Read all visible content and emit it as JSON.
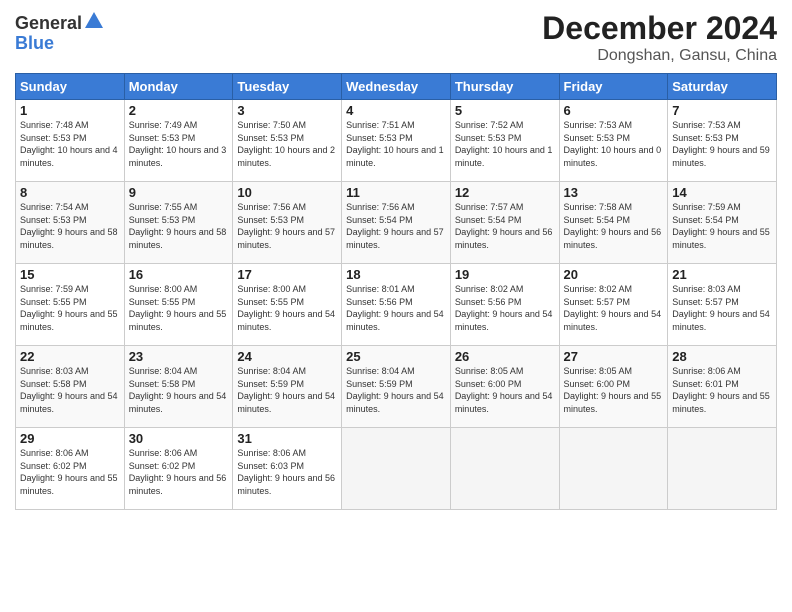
{
  "logo": {
    "general": "General",
    "blue": "Blue"
  },
  "header": {
    "month": "December 2024",
    "location": "Dongshan, Gansu, China"
  },
  "weekdays": [
    "Sunday",
    "Monday",
    "Tuesday",
    "Wednesday",
    "Thursday",
    "Friday",
    "Saturday"
  ],
  "weeks": [
    [
      {
        "day": "1",
        "sunrise": "7:48 AM",
        "sunset": "5:53 PM",
        "daylight": "10 hours and 4 minutes."
      },
      {
        "day": "2",
        "sunrise": "7:49 AM",
        "sunset": "5:53 PM",
        "daylight": "10 hours and 3 minutes."
      },
      {
        "day": "3",
        "sunrise": "7:50 AM",
        "sunset": "5:53 PM",
        "daylight": "10 hours and 2 minutes."
      },
      {
        "day": "4",
        "sunrise": "7:51 AM",
        "sunset": "5:53 PM",
        "daylight": "10 hours and 1 minute."
      },
      {
        "day": "5",
        "sunrise": "7:52 AM",
        "sunset": "5:53 PM",
        "daylight": "10 hours and 1 minute."
      },
      {
        "day": "6",
        "sunrise": "7:53 AM",
        "sunset": "5:53 PM",
        "daylight": "10 hours and 0 minutes."
      },
      {
        "day": "7",
        "sunrise": "7:53 AM",
        "sunset": "5:53 PM",
        "daylight": "9 hours and 59 minutes."
      }
    ],
    [
      {
        "day": "8",
        "sunrise": "7:54 AM",
        "sunset": "5:53 PM",
        "daylight": "9 hours and 58 minutes."
      },
      {
        "day": "9",
        "sunrise": "7:55 AM",
        "sunset": "5:53 PM",
        "daylight": "9 hours and 58 minutes."
      },
      {
        "day": "10",
        "sunrise": "7:56 AM",
        "sunset": "5:53 PM",
        "daylight": "9 hours and 57 minutes."
      },
      {
        "day": "11",
        "sunrise": "7:56 AM",
        "sunset": "5:54 PM",
        "daylight": "9 hours and 57 minutes."
      },
      {
        "day": "12",
        "sunrise": "7:57 AM",
        "sunset": "5:54 PM",
        "daylight": "9 hours and 56 minutes."
      },
      {
        "day": "13",
        "sunrise": "7:58 AM",
        "sunset": "5:54 PM",
        "daylight": "9 hours and 56 minutes."
      },
      {
        "day": "14",
        "sunrise": "7:59 AM",
        "sunset": "5:54 PM",
        "daylight": "9 hours and 55 minutes."
      }
    ],
    [
      {
        "day": "15",
        "sunrise": "7:59 AM",
        "sunset": "5:55 PM",
        "daylight": "9 hours and 55 minutes."
      },
      {
        "day": "16",
        "sunrise": "8:00 AM",
        "sunset": "5:55 PM",
        "daylight": "9 hours and 55 minutes."
      },
      {
        "day": "17",
        "sunrise": "8:00 AM",
        "sunset": "5:55 PM",
        "daylight": "9 hours and 54 minutes."
      },
      {
        "day": "18",
        "sunrise": "8:01 AM",
        "sunset": "5:56 PM",
        "daylight": "9 hours and 54 minutes."
      },
      {
        "day": "19",
        "sunrise": "8:02 AM",
        "sunset": "5:56 PM",
        "daylight": "9 hours and 54 minutes."
      },
      {
        "day": "20",
        "sunrise": "8:02 AM",
        "sunset": "5:57 PM",
        "daylight": "9 hours and 54 minutes."
      },
      {
        "day": "21",
        "sunrise": "8:03 AM",
        "sunset": "5:57 PM",
        "daylight": "9 hours and 54 minutes."
      }
    ],
    [
      {
        "day": "22",
        "sunrise": "8:03 AM",
        "sunset": "5:58 PM",
        "daylight": "9 hours and 54 minutes."
      },
      {
        "day": "23",
        "sunrise": "8:04 AM",
        "sunset": "5:58 PM",
        "daylight": "9 hours and 54 minutes."
      },
      {
        "day": "24",
        "sunrise": "8:04 AM",
        "sunset": "5:59 PM",
        "daylight": "9 hours and 54 minutes."
      },
      {
        "day": "25",
        "sunrise": "8:04 AM",
        "sunset": "5:59 PM",
        "daylight": "9 hours and 54 minutes."
      },
      {
        "day": "26",
        "sunrise": "8:05 AM",
        "sunset": "6:00 PM",
        "daylight": "9 hours and 54 minutes."
      },
      {
        "day": "27",
        "sunrise": "8:05 AM",
        "sunset": "6:00 PM",
        "daylight": "9 hours and 55 minutes."
      },
      {
        "day": "28",
        "sunrise": "8:06 AM",
        "sunset": "6:01 PM",
        "daylight": "9 hours and 55 minutes."
      }
    ],
    [
      {
        "day": "29",
        "sunrise": "8:06 AM",
        "sunset": "6:02 PM",
        "daylight": "9 hours and 55 minutes."
      },
      {
        "day": "30",
        "sunrise": "8:06 AM",
        "sunset": "6:02 PM",
        "daylight": "9 hours and 56 minutes."
      },
      {
        "day": "31",
        "sunrise": "8:06 AM",
        "sunset": "6:03 PM",
        "daylight": "9 hours and 56 minutes."
      },
      null,
      null,
      null,
      null
    ]
  ]
}
